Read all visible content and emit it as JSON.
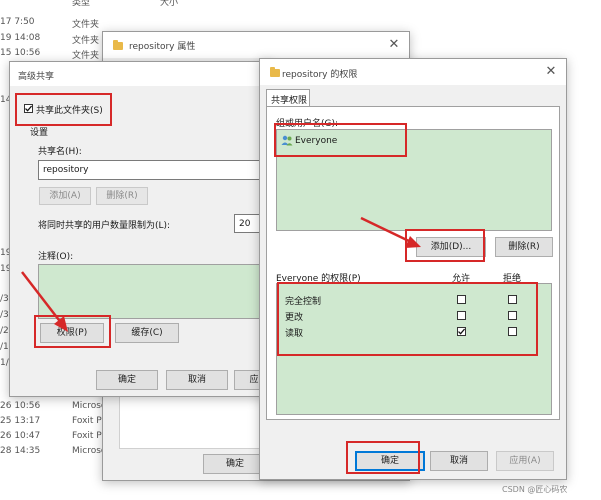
{
  "explorer": {
    "header_col1": "类型",
    "header_col2": "大小",
    "rows": [
      {
        "date": "17 7:50",
        "type": "文件夹"
      },
      {
        "date": "19 14:08",
        "type": "文件夹"
      },
      {
        "date": "15 10:56",
        "type": "文件夹"
      },
      {
        "date": "",
        "type": ""
      },
      {
        "date": "14",
        "type": ""
      },
      {
        "date": "26 10:56",
        "type": "Microsc"
      },
      {
        "date": "25 13:17",
        "type": "Foxit Ph"
      },
      {
        "date": "26 10:47",
        "type": "Foxit Ph"
      },
      {
        "date": "28 14:35",
        "type": "Microsc"
      }
    ],
    "left_fragments": [
      "19",
      "19",
      "/3",
      "/3",
      "/2",
      "/1",
      "1/"
    ]
  },
  "properties_window": {
    "title": "repository 属性",
    "ok_label": "确定"
  },
  "advanced_sharing": {
    "title": "高级共享",
    "share_checkbox_label": "共享此文件夹(S)",
    "share_checked": true,
    "settings_label": "设置",
    "share_name_label": "共享名(H):",
    "share_name_value": "repository",
    "add_label": "添加(A)",
    "remove_label": "删除(R)",
    "limit_label": "将同时共享的用户数量限制为(L):",
    "limit_value": "20",
    "comment_label": "注释(O):",
    "permissions_label": "权限(P)",
    "cache_label": "缓存(C)",
    "ok_label": "确定",
    "cancel_label": "取消",
    "apply_fragment": "应"
  },
  "permissions_dialog": {
    "title": "repository 的权限",
    "tab_label": "共享权限",
    "group_label": "组或用户名(G):",
    "users": [
      {
        "name": "Everyone"
      }
    ],
    "add_label": "添加(D)...",
    "remove_label": "删除(R)",
    "perm_for_label": "Everyone 的权限(P)",
    "allow_header": "允许",
    "deny_header": "拒绝",
    "permissions": [
      {
        "name": "完全控制",
        "allow": false,
        "deny": false
      },
      {
        "name": "更改",
        "allow": false,
        "deny": false
      },
      {
        "name": "读取",
        "allow": true,
        "deny": false
      }
    ],
    "ok_label": "确定",
    "cancel_label": "取消",
    "apply_label": "应用(A)"
  },
  "watermark": "CSDN @匠心码农",
  "colors": {
    "annotation_red": "#d62828",
    "highlight_green": "#cfe8cf",
    "window_bg": "#f0f0f0"
  }
}
